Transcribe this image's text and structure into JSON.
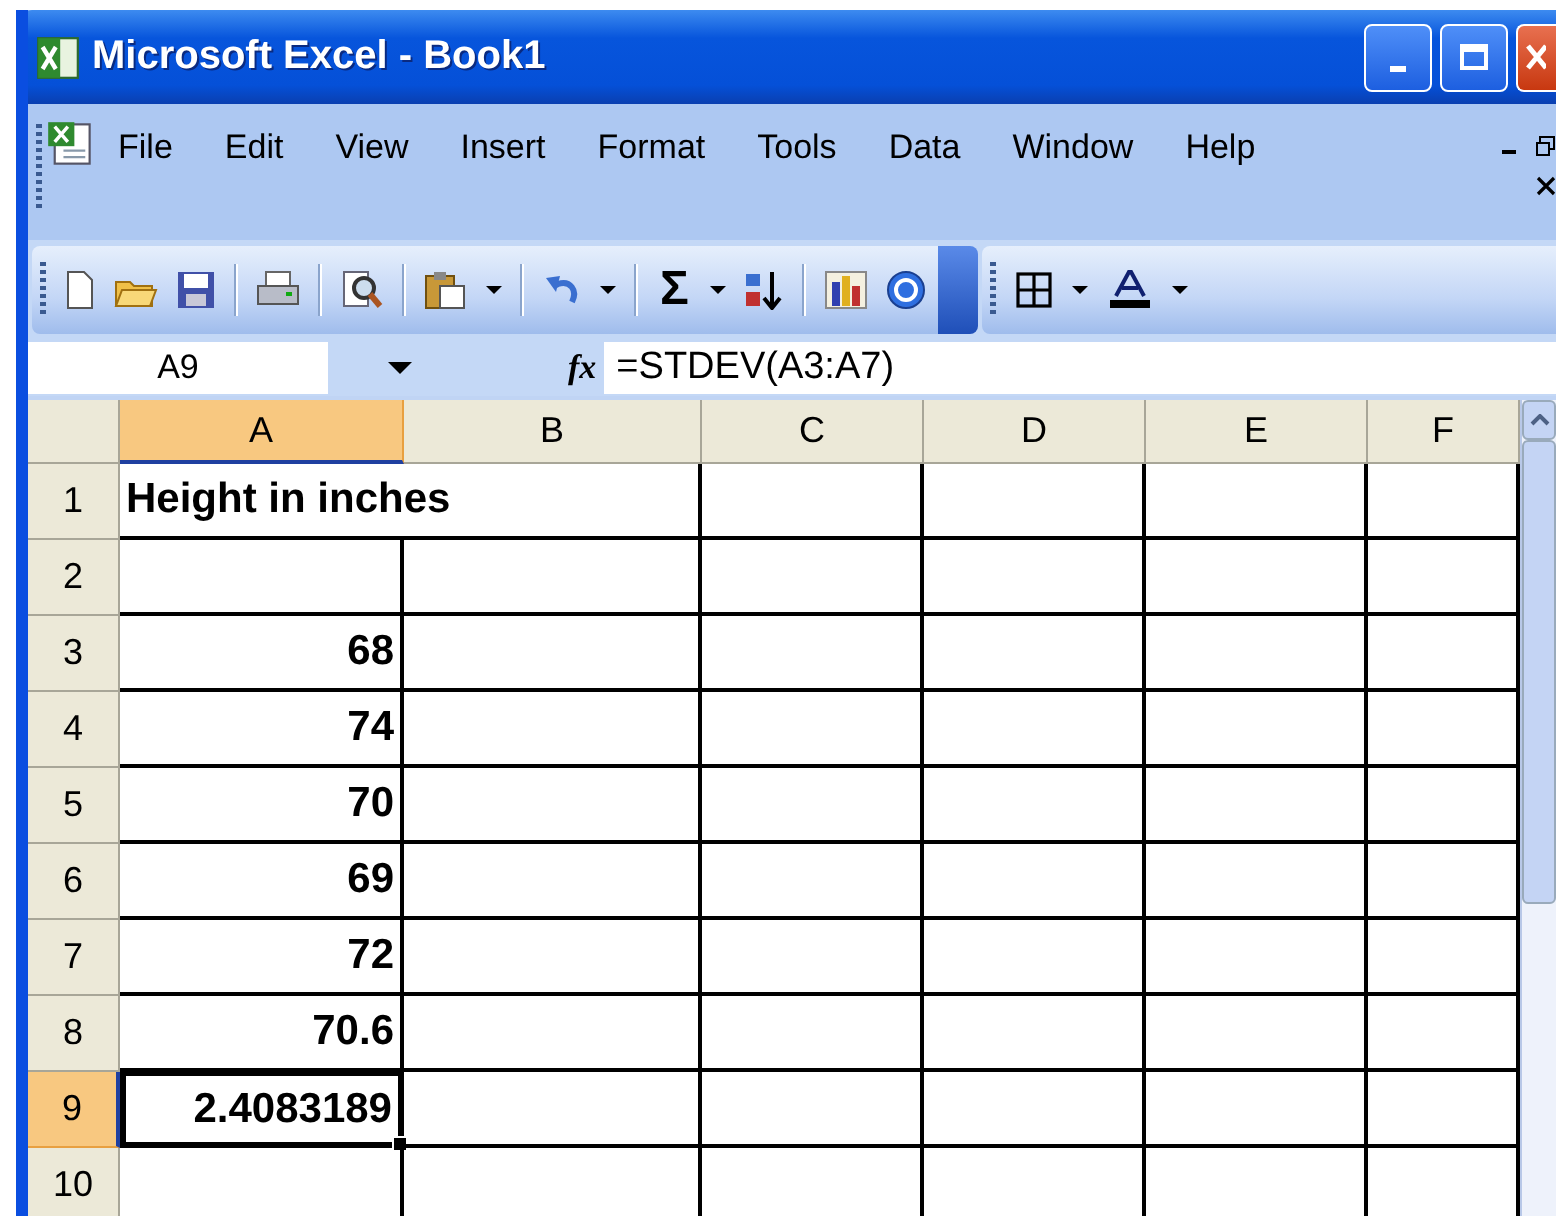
{
  "window": {
    "title": "Microsoft Excel - Book1"
  },
  "menu_bar": {
    "items": [
      {
        "label": "File"
      },
      {
        "label": "Edit"
      },
      {
        "label": "View"
      },
      {
        "label": "Insert"
      },
      {
        "label": "Format"
      },
      {
        "label": "Tools"
      },
      {
        "label": "Data"
      },
      {
        "label": "Window"
      },
      {
        "label": "Help"
      }
    ]
  },
  "toolbar": {
    "autosum_symbol": "Σ"
  },
  "formula_bar": {
    "name_box": "A9",
    "function_label": "fx",
    "formula": "=STDEV(A3:A7)"
  },
  "columns": [
    {
      "label": "A",
      "selected": true
    },
    {
      "label": "B",
      "selected": false
    },
    {
      "label": "C",
      "selected": false
    },
    {
      "label": "D",
      "selected": false
    },
    {
      "label": "E",
      "selected": false
    },
    {
      "label": "F",
      "selected": false
    }
  ],
  "rows": [
    {
      "label": "1",
      "selected": false,
      "cell_a": {
        "kind": "text",
        "text": "Height in inches"
      }
    },
    {
      "label": "2",
      "selected": false
    },
    {
      "label": "3",
      "selected": false,
      "cell_a": {
        "kind": "number",
        "text": "68"
      }
    },
    {
      "label": "4",
      "selected": false,
      "cell_a": {
        "kind": "number",
        "text": "74"
      }
    },
    {
      "label": "5",
      "selected": false,
      "cell_a": {
        "kind": "number",
        "text": "70"
      }
    },
    {
      "label": "6",
      "selected": false,
      "cell_a": {
        "kind": "number",
        "text": "69"
      }
    },
    {
      "label": "7",
      "selected": false,
      "cell_a": {
        "kind": "number",
        "text": "72"
      }
    },
    {
      "label": "8",
      "selected": false,
      "cell_a": {
        "kind": "number",
        "text": "70.6"
      }
    },
    {
      "label": "9",
      "selected": true,
      "cell_a": {
        "kind": "number",
        "text": "2.4083189"
      }
    },
    {
      "label": "10",
      "selected": false
    }
  ]
}
